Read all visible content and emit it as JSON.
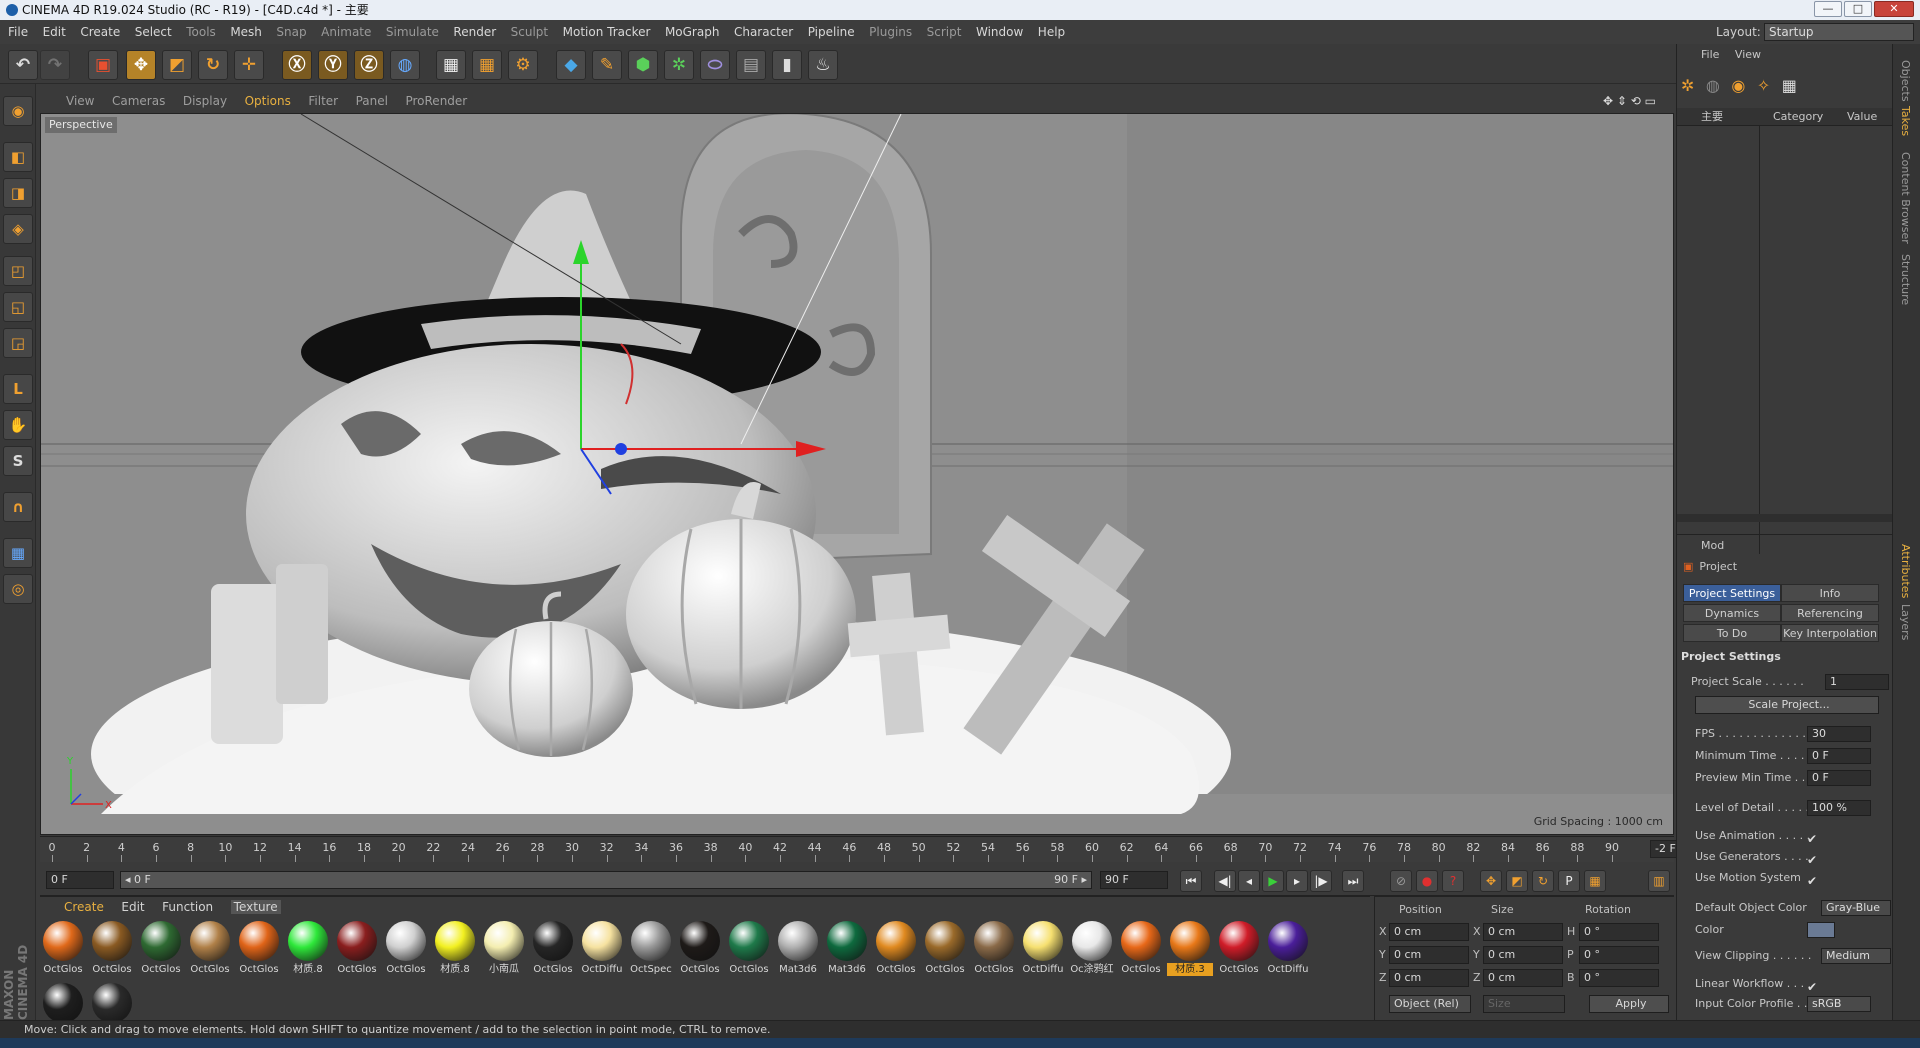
{
  "window": {
    "title": "CINEMA 4D R19.024 Studio (RC - R19) - [C4D.c4d *] - 主要",
    "min": "—",
    "max": "□",
    "close": "✕"
  },
  "menu": [
    "File",
    "Edit",
    "Create",
    "Select",
    "Tools",
    "Mesh",
    "Snap",
    "Animate",
    "Simulate",
    "Render",
    "Sculpt",
    "Motion Tracker",
    "MoGraph",
    "Character",
    "Pipeline",
    "Plugins",
    "Script",
    "Window",
    "Help"
  ],
  "layout": {
    "label": "Layout:",
    "value": "Startup"
  },
  "viewport": {
    "menu": [
      "View",
      "Cameras",
      "Display",
      "Options",
      "Filter",
      "Panel",
      "ProRender"
    ],
    "active_menu": "Options",
    "camera_label": "Perspective",
    "grid_spacing": "Grid Spacing : 1000 cm",
    "axis_y": "Y",
    "axis_x": "X"
  },
  "timeline": {
    "ticks": [
      "0",
      "2",
      "4",
      "6",
      "8",
      "10",
      "12",
      "14",
      "16",
      "18",
      "20",
      "22",
      "24",
      "26",
      "28",
      "30",
      "32",
      "34",
      "36",
      "38",
      "40",
      "42",
      "44",
      "46",
      "48",
      "50",
      "52",
      "54",
      "56",
      "58",
      "60",
      "62",
      "64",
      "66",
      "68",
      "70",
      "72",
      "74",
      "76",
      "78",
      "80",
      "82",
      "84",
      "86",
      "88",
      "90"
    ],
    "current_frame": "-2 F"
  },
  "playback": {
    "start": "0 F",
    "range_start": "◂ 0 F",
    "range_end": "90 F ▸",
    "end": "90 F"
  },
  "material_manager": {
    "menu": [
      "Create",
      "Edit",
      "Function",
      "Texture"
    ],
    "active_menu": "Texture",
    "materials": [
      {
        "name": "OctGlos",
        "color": "#e0691a"
      },
      {
        "name": "OctGlos",
        "color": "#8a5a22"
      },
      {
        "name": "OctGlos",
        "color": "#2e6a32"
      },
      {
        "name": "OctGlos",
        "color": "#b08048"
      },
      {
        "name": "OctGlos",
        "color": "#e06418"
      },
      {
        "name": "材质.8",
        "color": "#2ee83a"
      },
      {
        "name": "OctGlos",
        "color": "#8a1e1e"
      },
      {
        "name": "OctGlos",
        "color": "#d0d0d0"
      },
      {
        "name": "材质.8",
        "color": "#f2f020"
      },
      {
        "name": "小南瓜",
        "color": "#f4eeb0"
      },
      {
        "name": "OctGlos",
        "color": "#262626"
      },
      {
        "name": "OctDiffu",
        "color": "#f6e2a0"
      },
      {
        "name": "OctSpec",
        "color": "#9a9a9a"
      },
      {
        "name": "OctGlos",
        "color": "#1e1a18"
      },
      {
        "name": "OctGlos",
        "color": "#1e7a4a"
      },
      {
        "name": "Mat3d6",
        "color": "#b0b0b0"
      },
      {
        "name": "Mat3d6",
        "color": "#0e6a3e"
      },
      {
        "name": "OctGlos",
        "color": "#e08a20"
      },
      {
        "name": "OctGlos",
        "color": "#9a6a2a"
      },
      {
        "name": "OctGlos",
        "color": "#8a6a48"
      },
      {
        "name": "OctDiffu",
        "color": "#f6e070"
      },
      {
        "name": "Oc涂鸦红",
        "color": "#e8e8e8"
      },
      {
        "name": "OctGlos",
        "color": "#e86818"
      },
      {
        "name": "材质.3",
        "color": "#e87818"
      },
      {
        "name": "OctGlos",
        "color": "#d01c28"
      },
      {
        "name": "OctDiffu",
        "color": "#4a1e9a"
      },
      {
        "name": "",
        "color": "#1e1e1e"
      },
      {
        "name": "",
        "color": "#2a2a2a"
      }
    ],
    "selected_index": 23
  },
  "coordinates": {
    "headers": [
      "Position",
      "Size",
      "Rotation"
    ],
    "rows": [
      {
        "axis": "X",
        "pos": "0 cm",
        "saxis": "X",
        "size": "0 cm",
        "raxis": "H",
        "rot": "0 °"
      },
      {
        "axis": "Y",
        "pos": "0 cm",
        "saxis": "Y",
        "size": "0 cm",
        "raxis": "P",
        "rot": "0 °"
      },
      {
        "axis": "Z",
        "pos": "0 cm",
        "saxis": "Z",
        "size": "0 cm",
        "raxis": "B",
        "rot": "0 °"
      }
    ],
    "mode": "Object (Rel)",
    "size_mode": "Size",
    "apply": "Apply"
  },
  "objects_panel": {
    "menu": [
      "File",
      "View"
    ],
    "columns": [
      "主要",
      "Category",
      "Value"
    ]
  },
  "attributes": {
    "mode": "Mod",
    "title": "Project",
    "tabs": [
      "Project Settings",
      "Info",
      "Dynamics",
      "Referencing",
      "To Do",
      "Key Interpolation"
    ],
    "section": "Project Settings",
    "rows": [
      {
        "label": "Project Scale . . . . . .",
        "value": "1"
      },
      {
        "label": "FPS . . . . . . . . . . . . . .",
        "value": "30"
      },
      {
        "label": "Minimum Time . . . . .",
        "value": "0 F"
      },
      {
        "label": "Preview Min Time . . .",
        "value": "0 F"
      },
      {
        "label": "Level of Detail . . . . .",
        "value": "100 %"
      }
    ],
    "scale_button": "Scale Project...",
    "checks": [
      {
        "label": "Use Animation . . . . .",
        "mark": "✔"
      },
      {
        "label": "Use Generators . . . .",
        "mark": "✔"
      },
      {
        "label": "Use Motion System",
        "mark": "✔"
      }
    ],
    "default_color_label": "Default Object Color",
    "default_color_value": "Gray-Blue",
    "color_label": "Color",
    "view_clipping_label": "View Clipping . . . . . .",
    "view_clipping_value": "Medium",
    "linear_workflow_label": "Linear Workflow . . .",
    "linear_workflow_mark": "✔",
    "input_profile_label": "Input Color Profile . .",
    "input_profile_value": "sRGB"
  },
  "right_tabs": [
    "Objects",
    "Takes",
    "Content Browser",
    "Structure",
    "Attributes",
    "Layers"
  ],
  "brand": "MAXON CINEMA 4D",
  "status": "Move: Click and drag to move elements. Hold down SHIFT to quantize movement / add to the selection in point mode, CTRL to remove."
}
